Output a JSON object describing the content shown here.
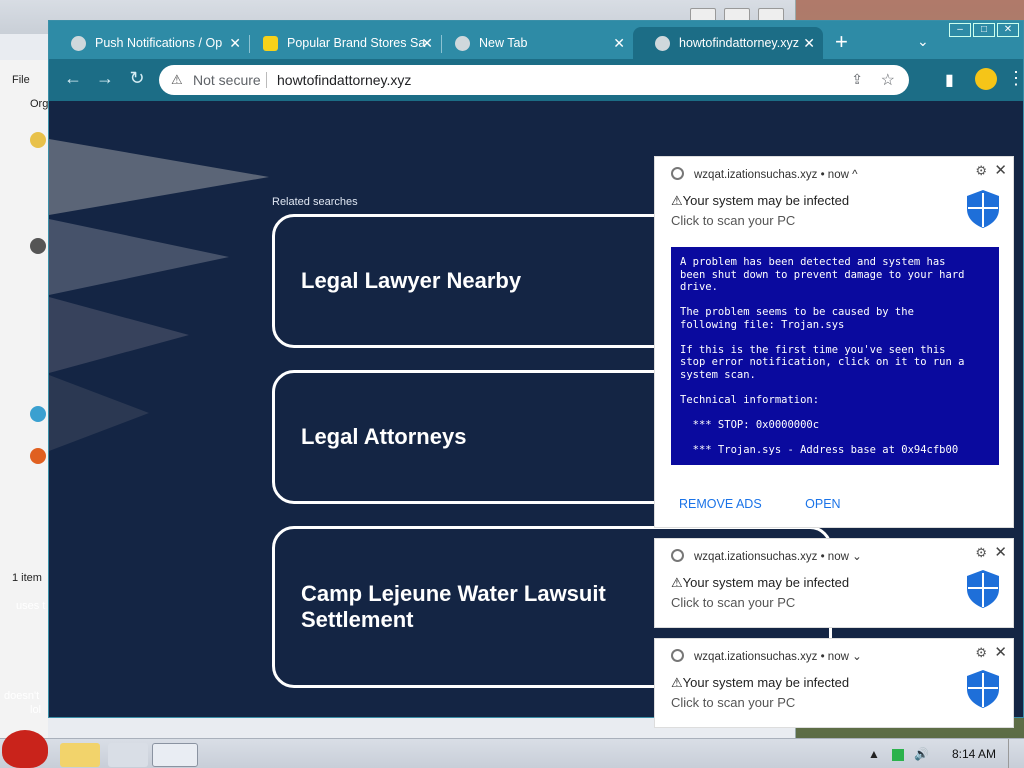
{
  "desktop": {
    "bg_window": {
      "menu_label": "File",
      "org_label": "Org",
      "status_left": "1 item",
      "snippets": [
        "uses t",
        "doesn't",
        "lol"
      ]
    }
  },
  "browser": {
    "tabs": [
      {
        "label": "Push Notifications / Op",
        "active": false
      },
      {
        "label": "Popular Brand Stores Sa",
        "active": false
      },
      {
        "label": "New Tab",
        "active": false
      },
      {
        "label": "howtofindattorney.xyz",
        "active": true
      }
    ],
    "new_tab_symbol": "+",
    "tab_list_symbol": "⌄",
    "omnibox": {
      "security_label": "Not secure",
      "url": "howtofindattorney.xyz"
    }
  },
  "page": {
    "related_label": "Related searches",
    "results": [
      {
        "label": "Legal Lawyer Nearby"
      },
      {
        "label": "Legal Attorneys"
      },
      {
        "label": "Camp Lejeune Water Lawsuit Settlement"
      }
    ]
  },
  "notifications": [
    {
      "source": "wzqat.izationsuchas.xyz",
      "time": "now",
      "expand_symbol": "^",
      "title": "⚠Your system may be infected",
      "body": "Click to scan your PC",
      "image_text": "A problem has been detected and system has\nbeen shut down to prevent damage to your hard\ndrive.\n\nThe problem seems to be caused by the\nfollowing file: Trojan.sys\n\nIf this is the first time you've seen this\nstop error notification, click on it to run a\nsystem scan.\n\nTechnical information:\n\n  *** STOP: 0x0000000c\n\n  *** Trojan.sys - Address base at 0x94cfb00",
      "actions": [
        "REMOVE ADS",
        "OPEN"
      ]
    },
    {
      "source": "wzqat.izationsuchas.xyz",
      "time": "now",
      "expand_symbol": "⌄",
      "title": "⚠Your system may be infected",
      "body": "Click to scan your PC"
    },
    {
      "source": "wzqat.izationsuchas.xyz",
      "time": "now",
      "expand_symbol": "⌄",
      "title": "⚠Your system may be infected",
      "body": "Click to scan your PC"
    }
  ],
  "taskbar": {
    "clock": "8:14 AM"
  },
  "colors": {
    "page_bg": "#142544",
    "chrome_frame": "#2e8ba6",
    "bsod_blue": "#0a0a9e",
    "link_blue": "#1a73e8",
    "shield_blue": "#1e6fd9"
  }
}
